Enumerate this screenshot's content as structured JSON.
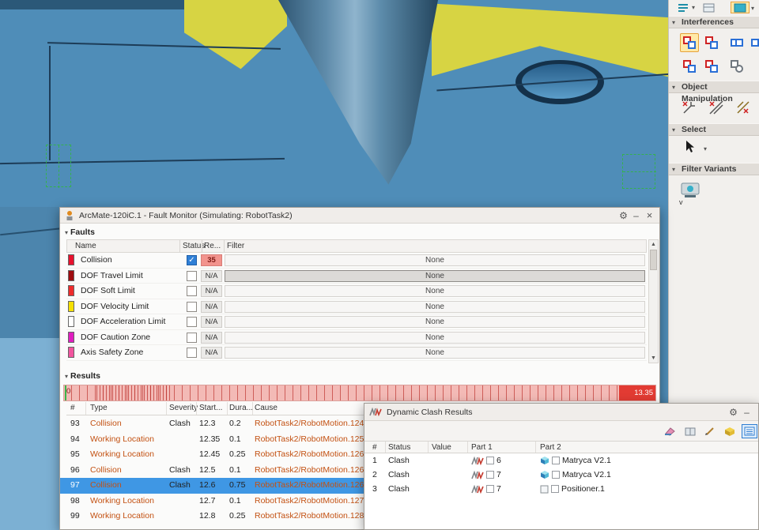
{
  "icons": {
    "gear": "⚙",
    "minimize": "–",
    "close": "×",
    "collapse": "▾",
    "dropdown": "▾",
    "scroll_up": "▲",
    "scroll_down": "▼",
    "check": "✓"
  },
  "right_panel": {
    "sections": [
      {
        "label": "Interferences"
      },
      {
        "label": "Object Manipulation"
      },
      {
        "label": "Select"
      },
      {
        "label": "Filter Variants"
      }
    ],
    "variant_label": "v"
  },
  "fault_monitor": {
    "title": "ArcMate-120iC.1 - Fault Monitor (Simulating: RobotTask2)",
    "faults_label": "Faults",
    "results_label": "Results",
    "faults_table": {
      "headers": {
        "name": "Name",
        "status": "Status",
        "count": "Re...",
        "filter": "Filter"
      },
      "rows": [
        {
          "name": "Collision",
          "swatch": "#e8112d",
          "checked": true,
          "count": "35",
          "filter": "None"
        },
        {
          "name": "DOF Travel Limit",
          "swatch": "#9e0b0f",
          "checked": false,
          "count": "N/A",
          "filter": "None"
        },
        {
          "name": "DOF Soft Limit",
          "swatch": "#ee2b2b",
          "checked": false,
          "count": "N/A",
          "filter": "None"
        },
        {
          "name": "DOF Velocity Limit",
          "swatch": "#f5e003",
          "checked": false,
          "count": "N/A",
          "filter": "None"
        },
        {
          "name": "DOF Acceleration Limit",
          "swatch": "#ffffff",
          "checked": false,
          "count": "N/A",
          "filter": "None"
        },
        {
          "name": "DOF Caution Zone",
          "swatch": "#e01ec0",
          "checked": false,
          "count": "N/A",
          "filter": "None"
        },
        {
          "name": "Axis Safety Zone",
          "swatch": "#f2559f",
          "checked": false,
          "count": "N/A",
          "filter": "None"
        }
      ]
    },
    "timeline": {
      "start_label": "0",
      "end_label": "13.35"
    },
    "results_table": {
      "headers": {
        "num": "#",
        "type": "Type",
        "severity": "Severity",
        "start": "Start...",
        "dura": "Dura...",
        "cause": "Cause"
      },
      "rows": [
        {
          "num": "93",
          "type": "Collision",
          "severity": "Clash",
          "start": "12.3",
          "dura": "0.2",
          "cause": "RobotTask2/RobotMotion.124"
        },
        {
          "num": "94",
          "type": "Working Location",
          "severity": "",
          "start": "12.35",
          "dura": "0.1",
          "cause": "RobotTask2/RobotMotion.125"
        },
        {
          "num": "95",
          "type": "Working Location",
          "severity": "",
          "start": "12.45",
          "dura": "0.25",
          "cause": "RobotTask2/RobotMotion.126"
        },
        {
          "num": "96",
          "type": "Collision",
          "severity": "Clash",
          "start": "12.5",
          "dura": "0.1",
          "cause": "RobotTask2/RobotMotion.126"
        },
        {
          "num": "97",
          "type": "Collision",
          "severity": "Clash",
          "start": "12.6",
          "dura": "0.75",
          "cause": "RobotTask2/RobotMotion.126"
        },
        {
          "num": "98",
          "type": "Working Location",
          "severity": "",
          "start": "12.7",
          "dura": "0.1",
          "cause": "RobotTask2/RobotMotion.127"
        },
        {
          "num": "99",
          "type": "Working Location",
          "severity": "",
          "start": "12.8",
          "dura": "0.25",
          "cause": "RobotTask2/RobotMotion.128"
        }
      ]
    }
  },
  "clash_results": {
    "title": "Dynamic Clash Results",
    "headers": {
      "num": "#",
      "status": "Status",
      "value": "Value",
      "part1": "Part 1",
      "part2": "Part 2"
    },
    "rows": [
      {
        "num": "1",
        "status": "Clash",
        "value": "",
        "part1": "6",
        "part2": "Matryca V2.1"
      },
      {
        "num": "2",
        "status": "Clash",
        "value": "",
        "part1": "7",
        "part2": "Matryca V2.1"
      },
      {
        "num": "3",
        "status": "Clash",
        "value": "",
        "part1": "7",
        "part2": "Positioner.1"
      }
    ]
  }
}
